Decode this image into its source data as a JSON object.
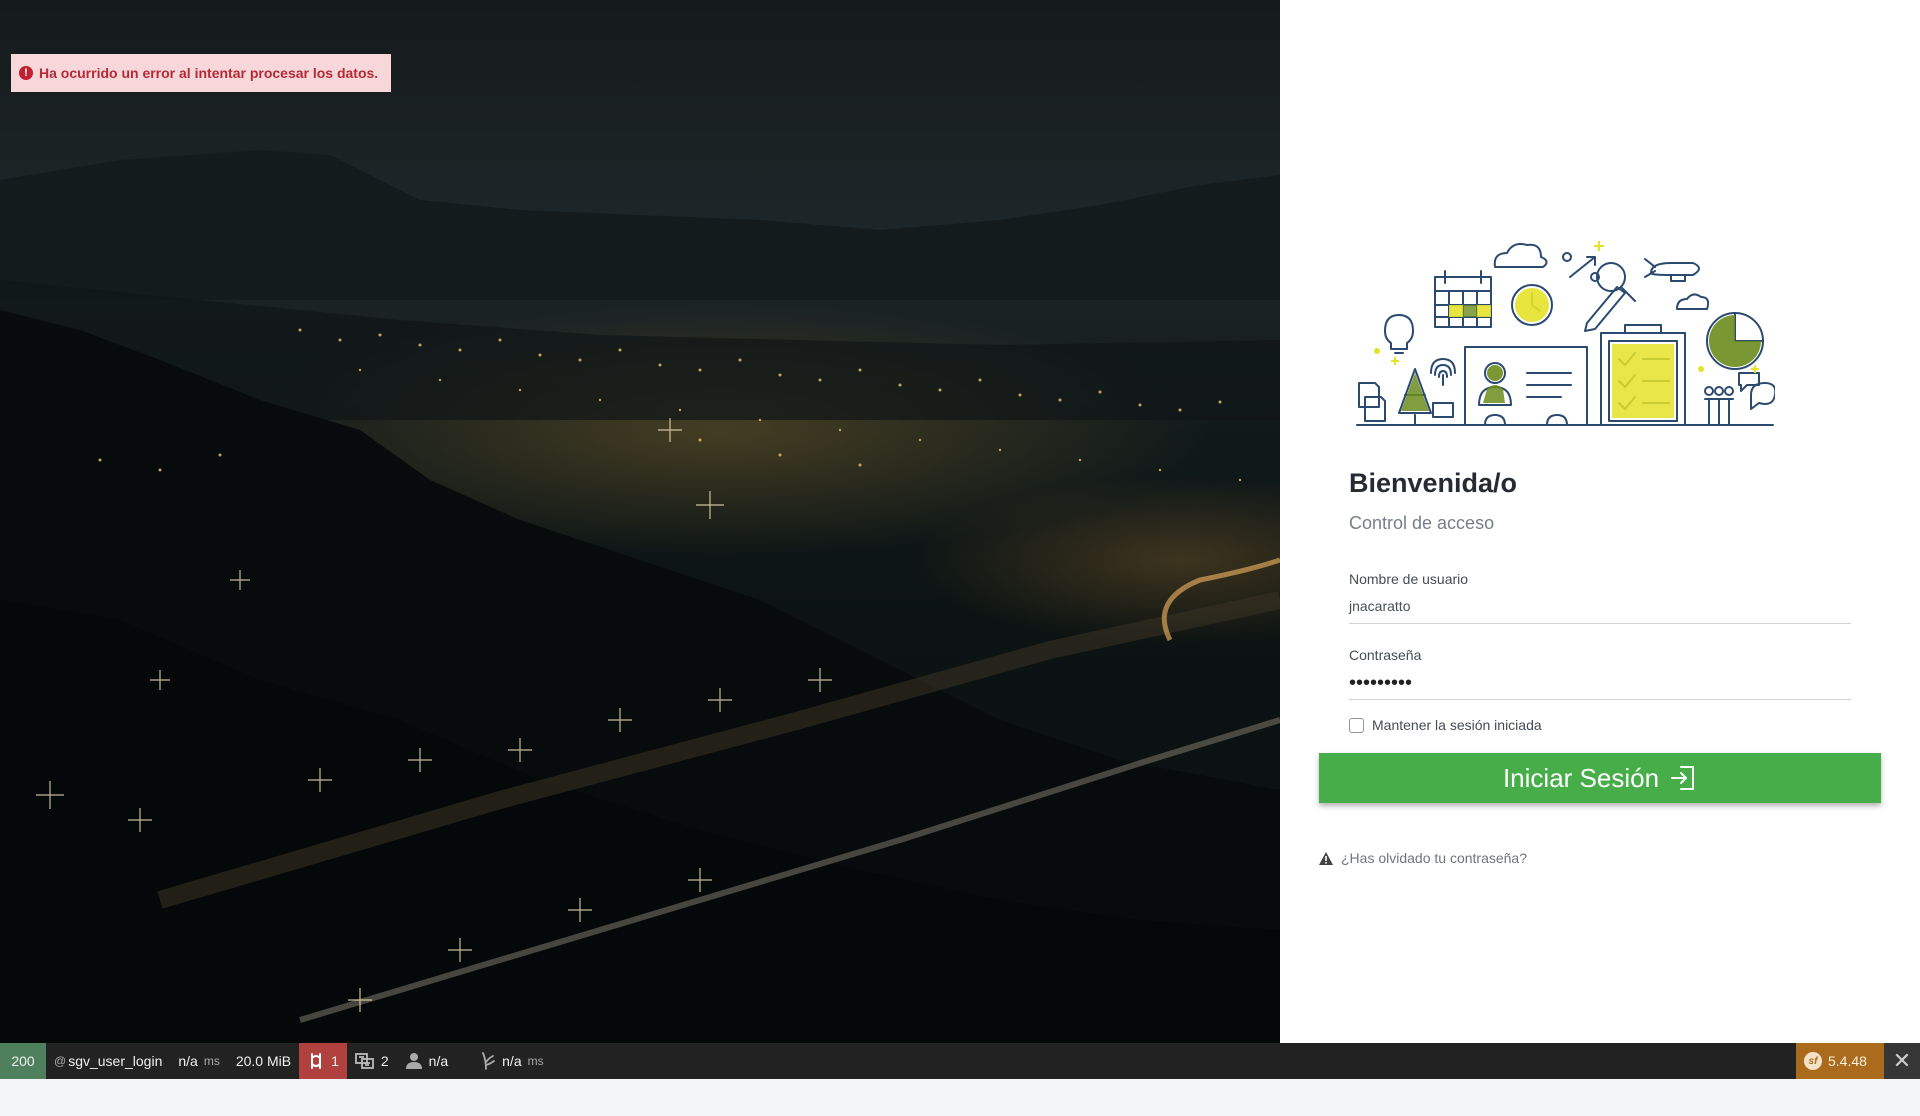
{
  "alert": {
    "message": "Ha ocurrido un error al intentar procesar los datos."
  },
  "login": {
    "title": "Bienvenida/o",
    "subtitle": "Control de acceso",
    "username_label": "Nombre de usuario",
    "username_value": "jnacaratto",
    "password_label": "Contraseña",
    "password_mask": "•••••••••",
    "remember_label": "Mantener la sesión iniciada",
    "submit_label": "Iniciar Sesión",
    "forgot_label": "¿Has olvidado tu contraseña?"
  },
  "toolbar": {
    "status": "200",
    "route_prefix": "@",
    "route": "sgv_user_login",
    "time_value": "n/a",
    "time_unit": "ms",
    "memory": "20.0 MiB",
    "requests_count": "1",
    "translations_count": "2",
    "user": "n/a",
    "render_value": "n/a",
    "render_unit": "ms",
    "version": "5.4.48",
    "close_glyph": "✕"
  },
  "colors": {
    "accent_green": "#46ad49",
    "error_bg": "#f8d7da",
    "error_text": "#b52a36",
    "toolbar_bg": "#222222",
    "illustration_yellow": "#e5e229",
    "illustration_olive": "#6b8c1e",
    "illustration_navy": "#2b4a6f"
  },
  "icons": {
    "alert": "exclamation-circle-icon",
    "submit": "sign-in-icon",
    "forgot": "warning-triangle-icon"
  }
}
